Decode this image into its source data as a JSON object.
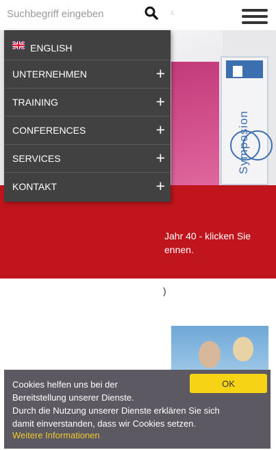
{
  "search": {
    "placeholder": "Suchbegriff eingeben"
  },
  "header": {
    "tiny_mark": "L"
  },
  "menu": {
    "language": "ENGLISH",
    "items": [
      {
        "label": "UNTERNEHMEN",
        "expand": "+"
      },
      {
        "label": "TRAINING",
        "expand": "+"
      },
      {
        "label": "CONFERENCES",
        "expand": "+"
      },
      {
        "label": "SERVICES",
        "expand": "+"
      },
      {
        "label": "KONTAKT",
        "expand": "+"
      }
    ]
  },
  "hero": {
    "magazine_title": "Symposion"
  },
  "teaser": {
    "line1": "Jahr 40 - klicken Sie",
    "line2": "ennen."
  },
  "fragment": ")",
  "cookie": {
    "line1": "Cookies helfen uns bei der",
    "line2": "Bereitstellung unserer Dienste.",
    "line3": "Durch die Nutzung unserer Dienste erklären Sie sich",
    "line4": "damit einverstanden, dass wir Cookies setzen.",
    "link": "Weitere Informationen",
    "ok": "OK"
  },
  "colors": {
    "menu_bg": "#414141",
    "teaser_red": "#c0151d",
    "cookie_bg": "#5c5962",
    "ok_yellow": "#f7d316",
    "link_yellow": "#f0c92a"
  }
}
